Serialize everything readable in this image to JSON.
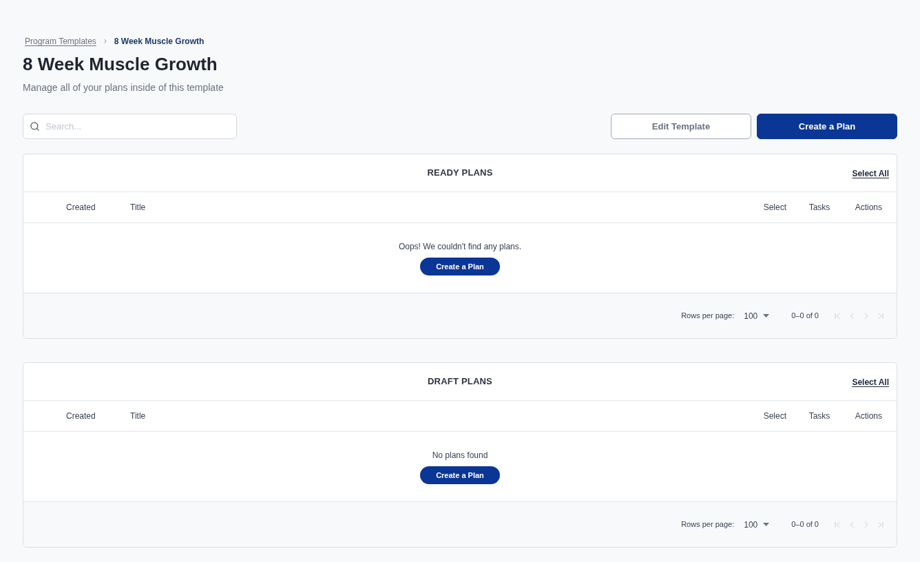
{
  "breadcrumb": [
    {
      "label": "Program Templates",
      "kind": "link"
    },
    {
      "label": "8 Week Muscle Growth",
      "kind": "current"
    }
  ],
  "page": {
    "title": "8 Week Muscle Growth",
    "subtitle": "Manage all of your plans inside of this template"
  },
  "search": {
    "placeholder": "Search..."
  },
  "buttons": [
    {
      "label": "Edit Template",
      "kind": "secondary"
    },
    {
      "label": "Create a Plan",
      "kind": "primary"
    }
  ],
  "tables": [
    {
      "title": "READY PLANS",
      "select_all": "Select All",
      "columns": [
        "Created",
        "Title",
        "Select",
        "Tasks",
        "Actions"
      ],
      "empty_message": "Oops! We couldn't find any plans.",
      "empty_action": "Create a Plan",
      "pagination": {
        "rows_per_page_label": "Rows per page:",
        "rows_per_page": "100",
        "range": "0–0 of 0",
        "nav": [
          {
            "kind": "first",
            "disabled": true
          },
          {
            "kind": "previous",
            "disabled": true
          },
          {
            "kind": "next",
            "disabled": true
          },
          {
            "kind": "last",
            "disabled": true
          }
        ]
      }
    },
    {
      "title": "DRAFT PLANS",
      "select_all": "Select All",
      "columns": [
        "Created",
        "Title",
        "Select",
        "Tasks",
        "Actions"
      ],
      "empty_message": "No plans found",
      "empty_action": "Create a Plan",
      "pagination": {
        "rows_per_page_label": "Rows per page:",
        "rows_per_page": "100",
        "range": "0–0 of 0",
        "nav": [
          {
            "kind": "first",
            "disabled": true
          },
          {
            "kind": "previous",
            "disabled": true
          },
          {
            "kind": "next",
            "disabled": true
          },
          {
            "kind": "last",
            "disabled": true
          }
        ]
      }
    }
  ]
}
